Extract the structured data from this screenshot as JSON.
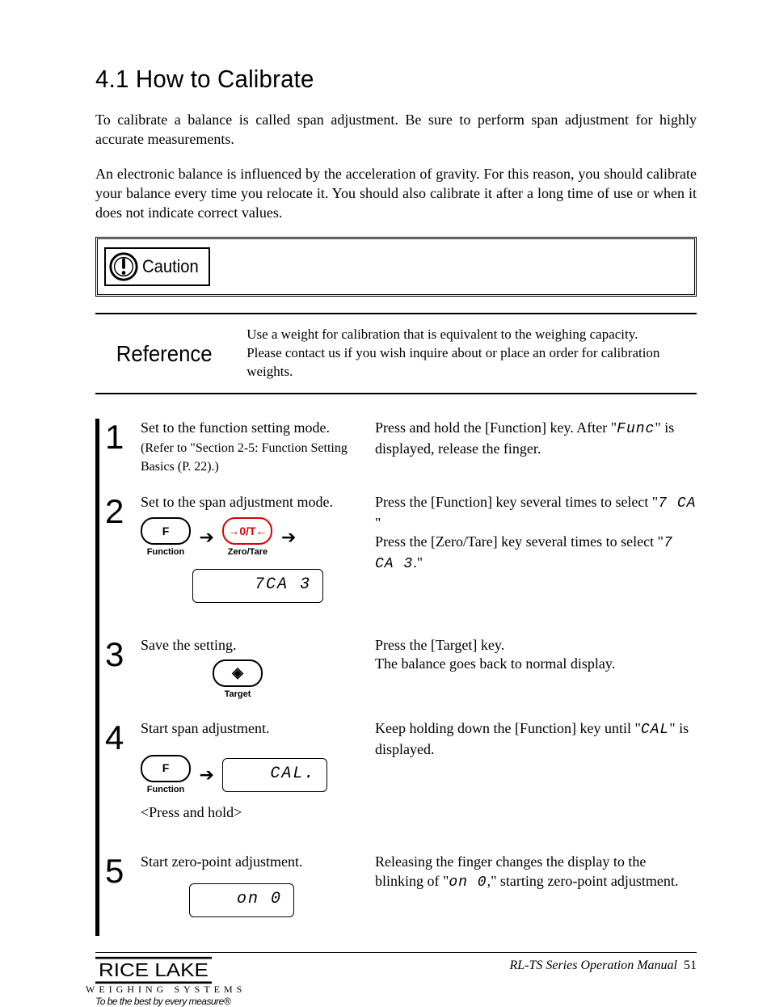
{
  "title": "4.1 How to Calibrate",
  "intro1": "To calibrate a balance is called span adjustment. Be sure to perform span adjustment for highly accurate measurements.",
  "intro2": "An electronic balance is influenced by the acceleration of gravity. For this reason, you should calibrate your balance every time you relocate it. You should also calibrate it after a long time of use or when it does not indicate correct values.",
  "caution_label": "Caution",
  "reference": {
    "heading": "Reference",
    "line1": "Use a weight for calibration that is equivalent to the weighing capacity.",
    "line2": "Please contact us if you wish inquire about or place an order for calibration weights."
  },
  "buttons": {
    "function_letter": "F",
    "function_label": "Function",
    "zerotare_symbol": "→0/T←",
    "zerotare_label": "Zero/Tare",
    "target_symbol": "◈",
    "target_label": "Target"
  },
  "lcd": {
    "step2": "7CA 3",
    "step4": "CAL.",
    "step5": "on 0"
  },
  "steps": [
    {
      "num": "1",
      "left_main": "Set to the function setting mode.",
      "left_sub": "(Refer to \"Section 2-5: Function Setting Basics (P. 22).)",
      "right_a": "Press and hold the [Function] key. After \"",
      "right_seg": "Func",
      "right_b": "\" is displayed, release the finger."
    },
    {
      "num": "2",
      "left_main": "Set to the span adjustment mode.",
      "right_line1_a": "Press the [Function] key several times to select \"",
      "right_line1_seg": "7  CA ",
      "right_line1_b": "\"",
      "right_line2_a": "Press the [Zero/Tare] key several times to select \"",
      "right_line2_seg": "7 CA 3",
      "right_line2_b": ".\""
    },
    {
      "num": "3",
      "left_main": "Save the setting.",
      "right_line1": "Press the [Target] key.",
      "right_line2": "The balance goes back to normal display."
    },
    {
      "num": "4",
      "left_main": "Start span adjustment.",
      "left_sub2": "<Press and hold>",
      "right_a": "Keep holding down the [Function] key until \"",
      "right_seg": "CAL",
      "right_b": "\" is displayed."
    },
    {
      "num": "5",
      "left_main": "Start zero-point adjustment.",
      "right_a": "Releasing the finger changes the display to the blinking of \"",
      "right_seg": "on 0",
      "right_b": ",\" starting zero-point adjustment."
    }
  ],
  "footer": {
    "brand": "RICE LAKE",
    "brand_sub": "WEIGHING SYSTEMS",
    "brand_tag": "To be the best by every measure®",
    "manual": "RL-TS Series Operation Manual",
    "page": "51"
  }
}
